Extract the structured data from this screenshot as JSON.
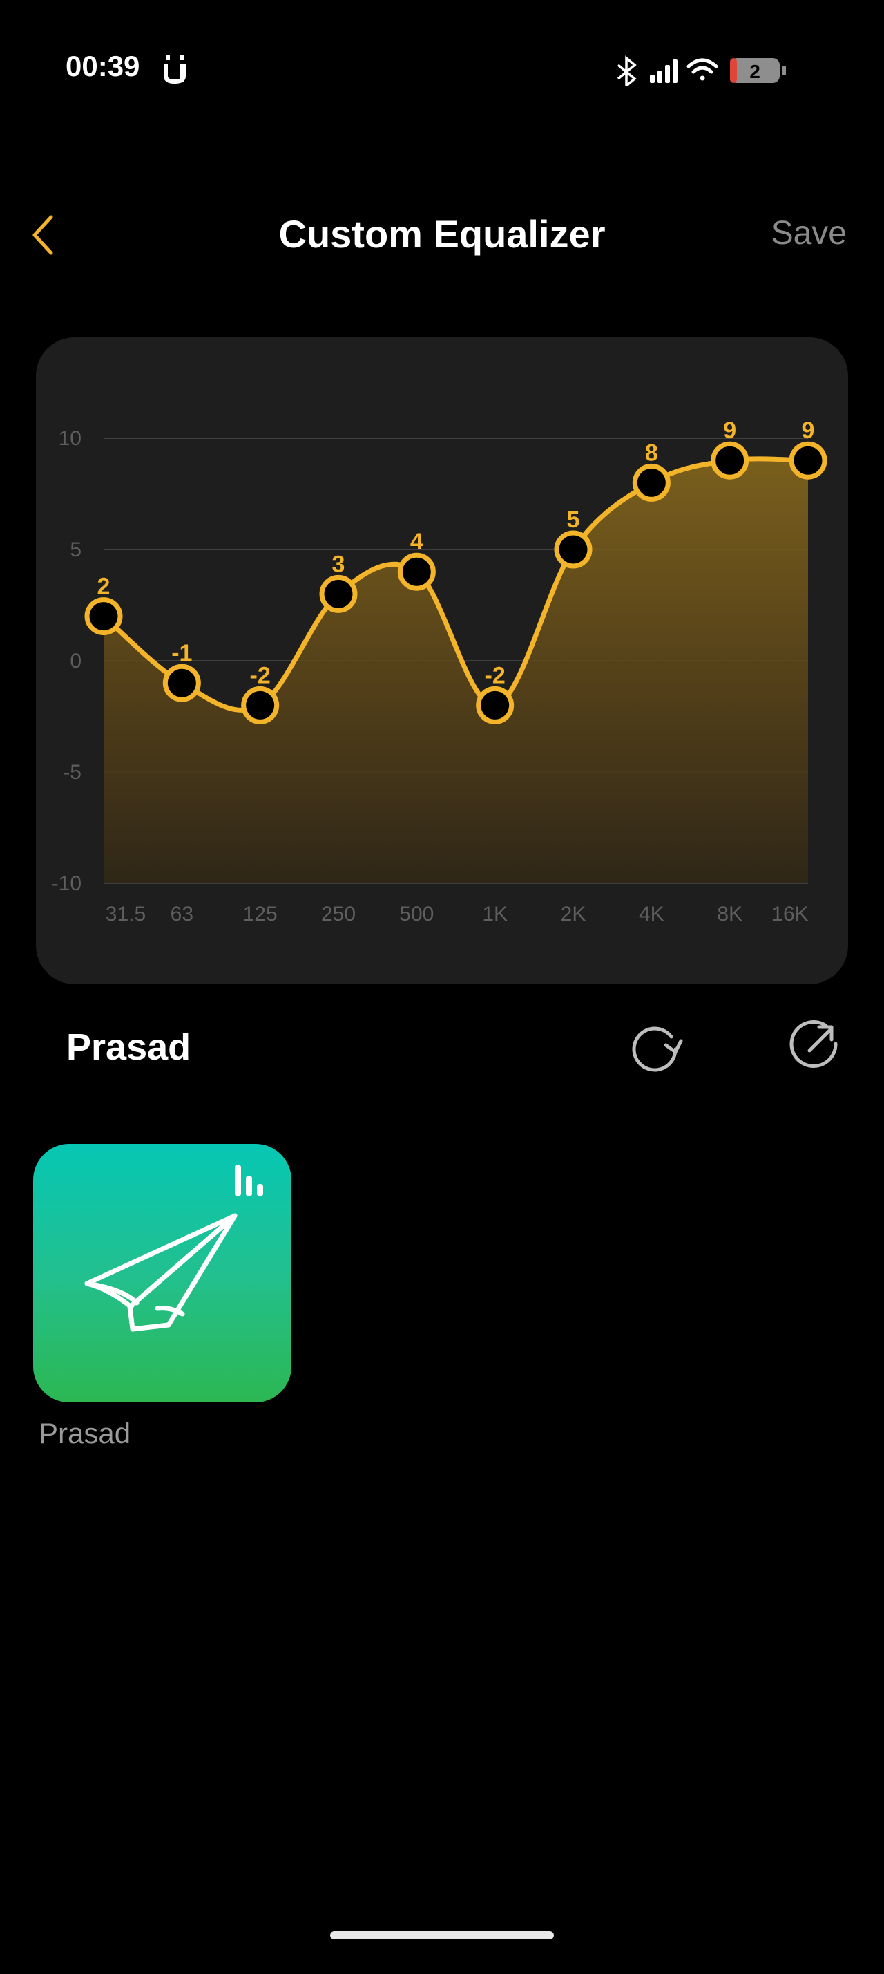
{
  "status_bar": {
    "time": "00:39",
    "battery": "2",
    "icons": [
      "u-app-icon",
      "bluetooth-icon",
      "cellular-signal-icon",
      "wifi-icon",
      "battery-icon"
    ]
  },
  "nav": {
    "title": "Custom Equalizer",
    "save_label": "Save",
    "back_icon": "chevron-left-icon"
  },
  "colors": {
    "accent": "#f4b42a",
    "card_bg": "#1e1e1e",
    "tile_top": "#06c7b4",
    "tile_bottom": "#2cb752"
  },
  "chart_data": {
    "type": "line",
    "categories": [
      "31.5",
      "63",
      "125",
      "250",
      "500",
      "1K",
      "2K",
      "4K",
      "8K",
      "16K"
    ],
    "values": [
      2,
      -1,
      -2,
      3,
      4,
      -2,
      5,
      8,
      9,
      9
    ],
    "y_ticks": [
      "10",
      "5",
      "0",
      "-5",
      "-10"
    ],
    "ylim": [
      -10,
      10
    ],
    "grid": true,
    "fill": "area-gradient"
  },
  "preset": {
    "name": "Prasad",
    "reset_icon": "reset-icon",
    "share_icon": "share-icon"
  },
  "presets_list": [
    {
      "label": "Prasad",
      "icon": "paper-plane-icon",
      "badge_icon": "equalizer-bars-icon"
    }
  ]
}
